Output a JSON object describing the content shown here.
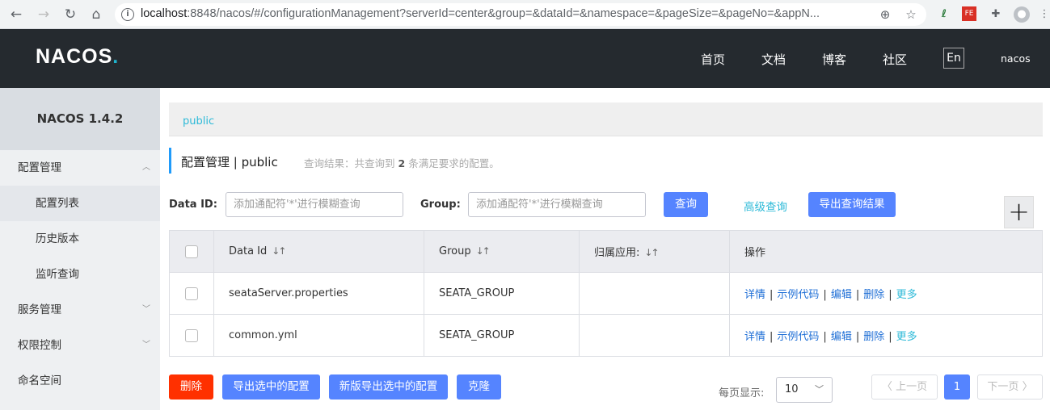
{
  "browser": {
    "url_host": "localhost",
    "url_path": ":8848/nacos/#/configurationManagement?serverId=center&group=&dataId=&namespace=&pageSize=&pageNo=&appN..."
  },
  "header": {
    "logo": "NACOS",
    "logo_dot": ".",
    "nav": [
      "首页",
      "文档",
      "博客",
      "社区"
    ],
    "lang": "En",
    "user": "nacos"
  },
  "sidebar": {
    "title": "NACOS 1.4.2",
    "items": [
      {
        "label": "配置管理"
      },
      {
        "label": "配置列表"
      },
      {
        "label": "历史版本"
      },
      {
        "label": "监听查询"
      },
      {
        "label": "服务管理"
      },
      {
        "label": "权限控制"
      },
      {
        "label": "命名空间"
      }
    ]
  },
  "namespace": "public",
  "page": {
    "title": "配置管理  |  public",
    "summary_prefix": "查询结果：共查询到",
    "summary_count": "2",
    "summary_suffix": "条满足要求的配置。"
  },
  "search": {
    "dataid_label": "Data ID:",
    "dataid_placeholder": "添加通配符'*'进行模糊查询",
    "group_label": "Group:",
    "group_placeholder": "添加通配符'*'进行模糊查询",
    "query_btn": "查询",
    "advanced": "高级查询",
    "export_result": "导出查询结果"
  },
  "table": {
    "headers": [
      "Data Id",
      "Group",
      "归属应用:",
      "操作"
    ],
    "sort_icon": "↓↑",
    "rows": [
      {
        "data_id": "seataServer.properties",
        "group": "SEATA_GROUP",
        "app": ""
      },
      {
        "data_id": "common.yml",
        "group": "SEATA_GROUP",
        "app": ""
      }
    ],
    "ops": [
      "详情",
      "示例代码",
      "编辑",
      "删除",
      "更多"
    ]
  },
  "footer": {
    "delete": "删除",
    "export_selected": "导出选中的配置",
    "export_selected_new": "新版导出选中的配置",
    "clone": "克隆",
    "page_size_label": "每页显示:",
    "page_size": "10",
    "prev": "上一页",
    "page": "1",
    "next": "下一页"
  },
  "colors": {
    "header_bg": "#252a2f",
    "primary": "#5584ff",
    "danger": "#ff3000",
    "accent": "#2ebad8"
  }
}
